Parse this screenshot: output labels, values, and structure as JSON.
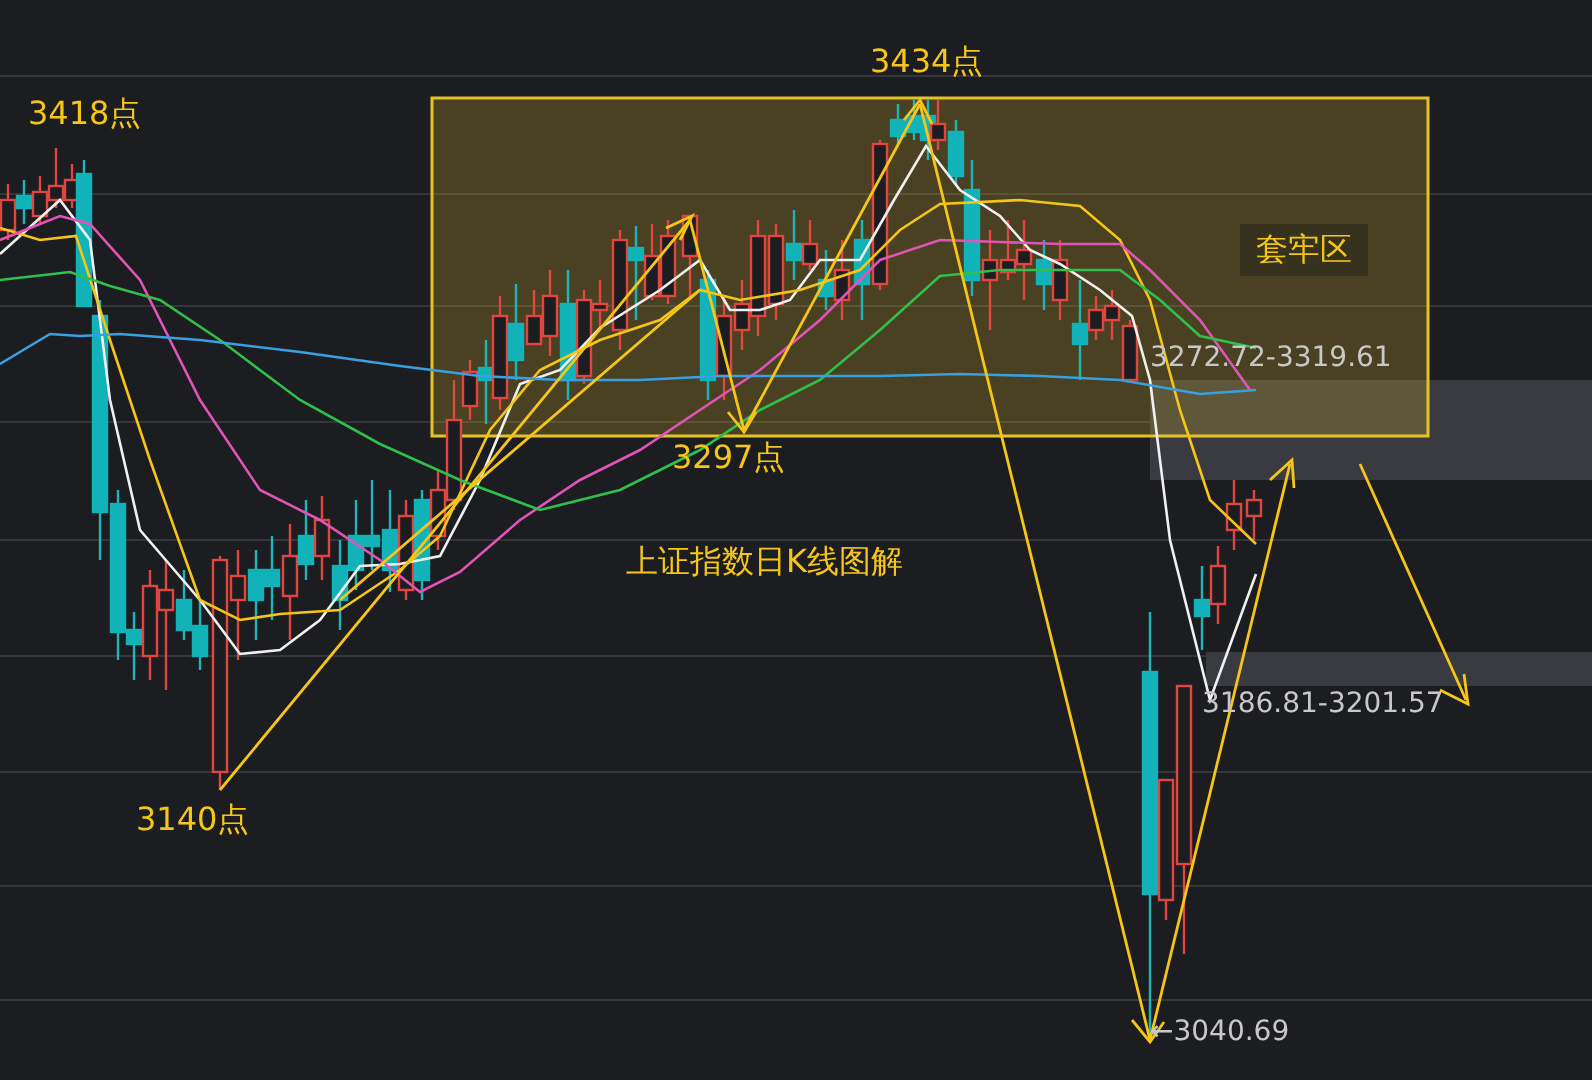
{
  "chart": {
    "title": "上证指数日K线图解",
    "point_labels": [
      "3418点",
      "3434点",
      "3297点",
      "3140点"
    ],
    "zone": {
      "label": "套牢区",
      "range": "3272.72-3319.61"
    },
    "support_range": "3186.81-3201.57",
    "low_marker": "←3040.69"
  }
}
